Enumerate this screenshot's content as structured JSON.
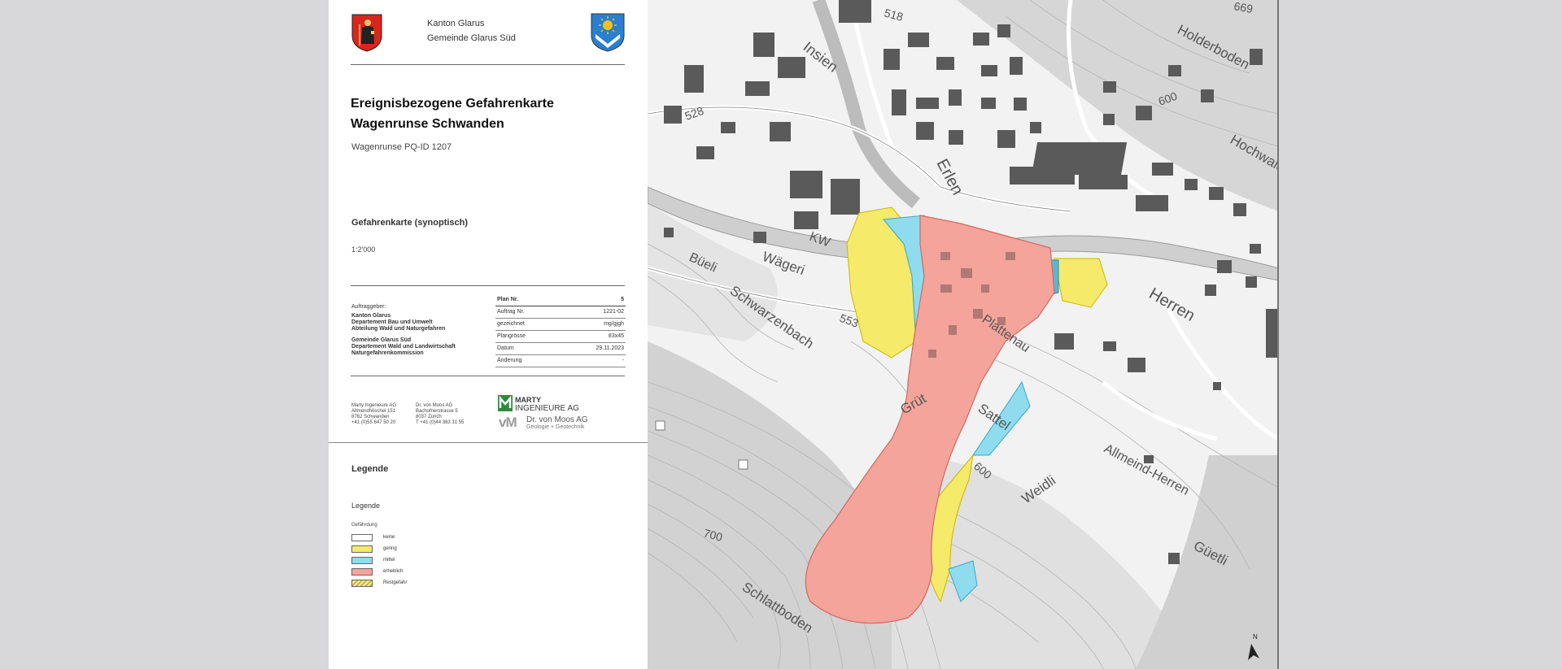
{
  "header": {
    "canton": "Kanton Glarus",
    "municipality": "Gemeinde Glarus Süd"
  },
  "title": {
    "line1": "Ereignisbezogene Gefahrenkarte",
    "line2": "Wagenrunse Schwanden",
    "id": "Wagenrunse PQ-ID 1207",
    "kind": "Gefahrenkarte (synoptisch)",
    "scale": "1:2'000"
  },
  "client": {
    "label": "Auftraggeber:",
    "line1": "Kanton Glarus",
    "line2": "Departement Bau und Umwelt",
    "line3": "Abteilung Wald und Naturgefahren",
    "line4": "Gemeinde Glarus Süd",
    "line5": "Departement Wald und Landwirtschaft",
    "line6": "Naturgefahrenkommission"
  },
  "plan_table": [
    {
      "key": "Plan Nr.",
      "value": "5"
    },
    {
      "key": "Auftrag Nr.",
      "value": "1221-02"
    },
    {
      "key": "gezeichnet",
      "value": "mg/gjgh"
    },
    {
      "key": "Plangrösse",
      "value": "83x45"
    },
    {
      "key": "Datum",
      "value": "29.11.2023"
    },
    {
      "key": "Änderung",
      "value": "-"
    }
  ],
  "addresses": {
    "marty": {
      "l1": "Marty Ingenieure AG",
      "l2": "Allmendhöschel 151",
      "l3": "8762 Schwanden",
      "l4": "+41 (0)55 647 50 20"
    },
    "vonmoos": {
      "l1": "Dr. von Moos AG",
      "l2": "Bachofnerstrasse 5",
      "l3": "8037 Zürich",
      "l4": "T +41 (0)44 363 31 55"
    }
  },
  "logos": {
    "marty_name": "MARTY",
    "marty_sub": "INGENIEURE AG",
    "vm_mark": "vM",
    "vm_name": "Dr. von Moos AG",
    "vm_sub": "Geologie + Geotechnik"
  },
  "legend": {
    "heading": "Legende",
    "subheading": "Legende",
    "category": "Gefährdung",
    "items": [
      {
        "label": "keine",
        "color": "#ffffff"
      },
      {
        "label": "gering",
        "color": "#f5ea6a"
      },
      {
        "label": "mittel",
        "color": "#8fdcef"
      },
      {
        "label": "erheblich",
        "color": "#f4a49a"
      },
      {
        "label": "Restgefahr",
        "color": "#f5ea6a"
      }
    ]
  },
  "map": {
    "places": [
      "Insien",
      "Holderboden",
      "Hochwald",
      "Erlen",
      "Büeli",
      "Wägeri",
      "Schwarzenbach",
      "Herren",
      "Plattenau",
      "Grüt",
      "Sattel",
      "Allmeind-Herren",
      "Weidli",
      "Güetli",
      "Schlattboden",
      "KW"
    ],
    "contours": [
      "600",
      "600",
      "700",
      "553",
      "528",
      "518",
      "669"
    ],
    "north": "N"
  },
  "colors": {
    "hazard_low": "#f5ea6a",
    "hazard_medium": "#8fdcef",
    "hazard_high": "#f4a49a"
  }
}
